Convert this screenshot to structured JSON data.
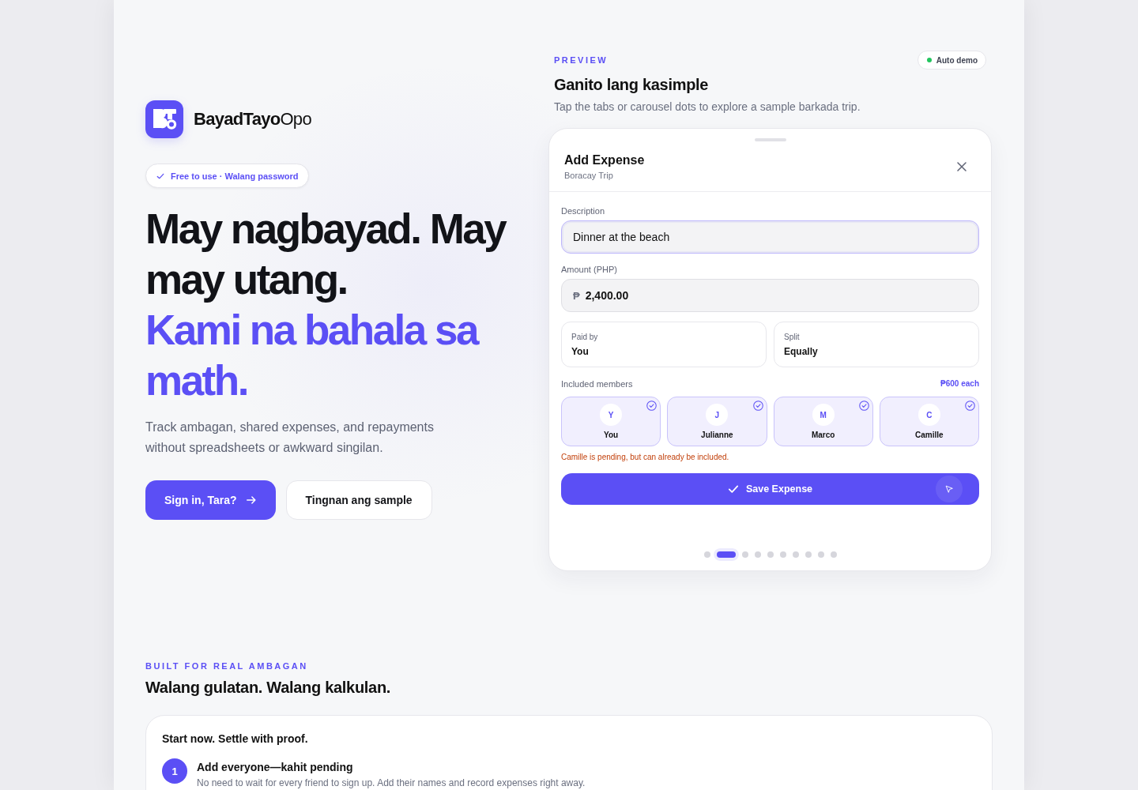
{
  "brand": {
    "name": "**BayadTayo**Opo"
  },
  "badge": {
    "text": "Free to use · Walang password"
  },
  "hero": {
    "headline": "May nagbayad. May may utang.",
    "headline_accent": "Kami na bahala sa math.",
    "description": "Track ambagan, shared expenses, and repayments without spreadsheets or awkward singilan."
  },
  "actions": [
    {
      "label": "Sign in, Tara?",
      "kind": "primary"
    },
    {
      "label": "Tingnan ang sample",
      "kind": "secondary"
    }
  ],
  "preview": {
    "eyebrow": "PREVIEW",
    "status": "Auto demo",
    "title": "Ganito lang kasimple",
    "subtitle": "Tap the tabs or carousel dots to explore a sample barkada trip."
  },
  "sheet": {
    "title": "Add Expense",
    "subtitle": "Boracay Trip",
    "fields": [
      {
        "label": "Description",
        "value": "Dinner at the beach",
        "focused": true
      },
      {
        "label": "Amount (PHP)",
        "prefix": "₱",
        "value": "2,400.00",
        "focused": false
      }
    ],
    "options": [
      {
        "label": "Paid by",
        "value": "You"
      },
      {
        "label": "Split",
        "value": "Equally"
      }
    ],
    "members_label": "Included members",
    "share": "₱600 each",
    "members": [
      {
        "initial": "Y",
        "name": "You",
        "included": true
      },
      {
        "initial": "J",
        "name": "Julianne",
        "included": true
      },
      {
        "initial": "M",
        "name": "Marco",
        "included": true
      },
      {
        "initial": "C",
        "name": "Camille",
        "included": true
      }
    ],
    "note": "Camille is pending, but can already be included.",
    "save_button": "Save Expense"
  },
  "carousel_dots": [
    {
      "selected": false
    },
    {
      "selected": true
    },
    {
      "selected": false
    },
    {
      "selected": false
    },
    {
      "selected": false
    },
    {
      "selected": false
    },
    {
      "selected": false
    },
    {
      "selected": false
    },
    {
      "selected": false
    },
    {
      "selected": false
    }
  ],
  "features": {
    "eyebrow": "BUILT FOR REAL AMBAGAN",
    "title": "Walang gulatan. Walang kalkulan.",
    "card_title": "Start now. Settle with proof.",
    "steps": [
      {
        "number": "1",
        "title": "Add everyone—kahit pending",
        "description": "No need to wait for every friend to sign up. Add their names and record expenses right away."
      }
    ]
  }
}
